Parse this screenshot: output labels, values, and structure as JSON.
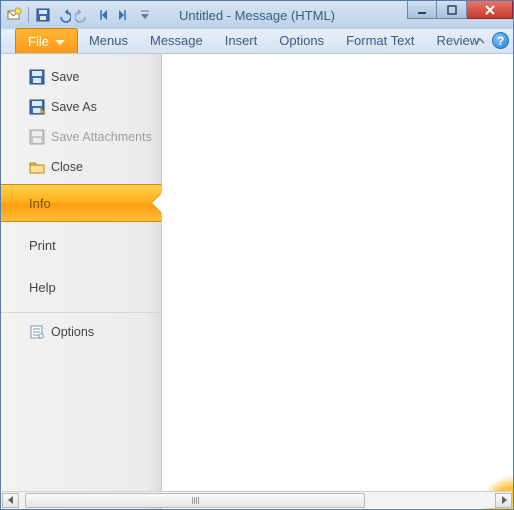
{
  "titlebar": {
    "title": "Untitled - Message (HTML)"
  },
  "ribbon": {
    "file": "File",
    "tabs": [
      "Menus",
      "Message",
      "Insert",
      "Options",
      "Format Text",
      "Review"
    ],
    "help": "?"
  },
  "backstage": {
    "quick": {
      "save": "Save",
      "saveAs": "Save As",
      "saveAttachments": "Save Attachments",
      "close": "Close"
    },
    "info": "Info",
    "print": "Print",
    "help": "Help",
    "options": "Options"
  }
}
